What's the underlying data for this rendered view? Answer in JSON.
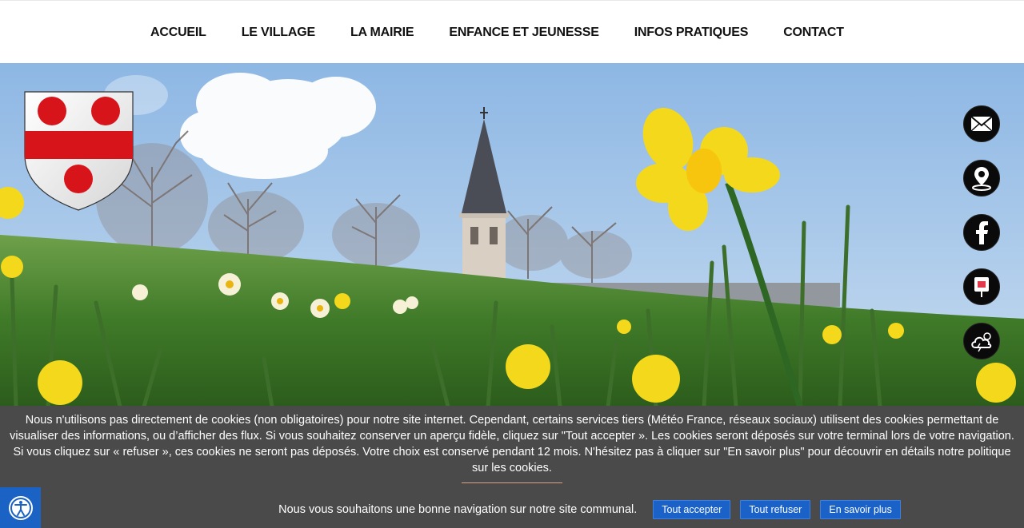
{
  "nav": {
    "items": [
      {
        "label": "ACCUEIL"
      },
      {
        "label": "LE VILLAGE"
      },
      {
        "label": "LA MAIRIE"
      },
      {
        "label": "ENFANCE ET JEUNESSE"
      },
      {
        "label": "INFOS PRATIQUES"
      },
      {
        "label": "CONTACT"
      }
    ]
  },
  "hero": {
    "crest_icon": "coat-of-arms-icon",
    "side_icons": [
      "mail-icon",
      "location-pin-icon",
      "facebook-icon",
      "app-icon",
      "weather-icon"
    ]
  },
  "cookie": {
    "text": "Nous n'utilisons pas directement de cookies (non obligatoires) pour notre site internet. Cependant, certains services tiers (Météo France, réseaux sociaux) utilisent des cookies permettant de visualiser des informations, ou d’afficher des flux. Si vous souhaitez conserver un aperçu fidèle, cliquez sur \"Tout accepter ». Les cookies seront déposés sur votre terminal lors de votre navigation. Si vous cliquez sur « refuser », ces cookies ne seront pas déposés. Votre choix est conservé pendant 12 mois. N'hésitez pas à cliquer sur \"En savoir plus\" pour découvrir en détails notre politique sur les cookies.",
    "wish": "Nous vous souhaitons une bonne navigation sur notre site communal.",
    "accept_label": "Tout accepter",
    "refuse_label": "Tout refuser",
    "more_label": "En savoir plus"
  },
  "accessibility": {
    "icon": "accessibility-icon"
  },
  "colors": {
    "banner_bg": "#4a4a4a",
    "button_blue": "#1a62c8",
    "crest_red": "#d8141b",
    "sky": "#9cc3ea",
    "grass": "#4f8a2e",
    "daffodil": "#f3d81c"
  }
}
